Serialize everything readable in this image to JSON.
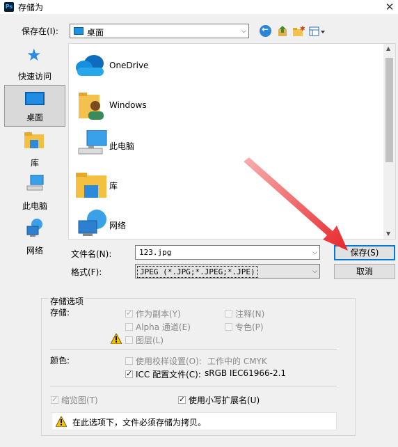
{
  "title_bar": {
    "app_icon": "Ps",
    "title": "存储为",
    "close": "✕"
  },
  "save_in": {
    "label": "保存在(I):",
    "value": "桌面"
  },
  "places": [
    {
      "label": "快速访问",
      "icon": "star-icon"
    },
    {
      "label": "桌面",
      "icon": "desktop-icon",
      "selected": true
    },
    {
      "label": "库",
      "icon": "library-icon"
    },
    {
      "label": "此电脑",
      "icon": "computer-icon"
    },
    {
      "label": "网络",
      "icon": "network-icon"
    }
  ],
  "files": [
    {
      "name": "OneDrive",
      "icon": "cloud-icon"
    },
    {
      "name": "Windows",
      "icon": "user-folder-icon"
    },
    {
      "name": "此电脑",
      "icon": "computer-icon"
    },
    {
      "name": "库",
      "icon": "library-icon"
    },
    {
      "name": "网络",
      "icon": "network-icon"
    }
  ],
  "filename": {
    "label": "文件名(N):",
    "value": "123.jpg"
  },
  "format": {
    "label": "格式(F):",
    "value": "JPEG (*.JPG;*.JPEG;*.JPE)"
  },
  "buttons": {
    "save": "保存(S)",
    "cancel": "取消"
  },
  "options": {
    "group_label": "存储选项",
    "store_label": "存储:",
    "as_copy": "作为副本(Y)",
    "notes": "注释(N)",
    "alpha": "Alpha 通道(E)",
    "spot": "专色(P)",
    "layers": "图层(L)",
    "color_label": "颜色:",
    "use_proof": "使用校样设置(O):",
    "proof_value": "工作中的 CMYK",
    "icc": "ICC 配置文件(C):",
    "icc_value": "sRGB IEC61966-2.1",
    "thumbnail": "缩览图(T)",
    "lowercase_ext": "使用小写扩展名(U)",
    "warning": "在此选项下，文件必须存储为拷贝。"
  },
  "colors": {
    "accent": "#0078d7",
    "arrow": "#e8262a"
  }
}
